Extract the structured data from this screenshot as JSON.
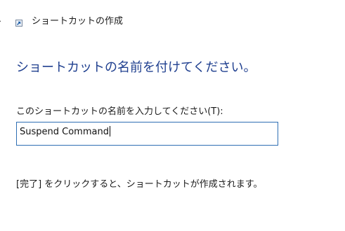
{
  "window": {
    "title": "ショートカットの作成",
    "icon": "shortcut-icon",
    "back_icon": "back-arrow-icon"
  },
  "main": {
    "heading": "ショートカットの名前を付けてください。",
    "name_field": {
      "label": "このショートカットの名前を入力してください(T):",
      "value": "Suspend Command"
    },
    "info": "[完了] をクリックすると、ショートカットが作成されます。"
  },
  "colors": {
    "heading": "#1f3f8f",
    "input_border": "#2f6fb3",
    "background": "#ffffff"
  }
}
